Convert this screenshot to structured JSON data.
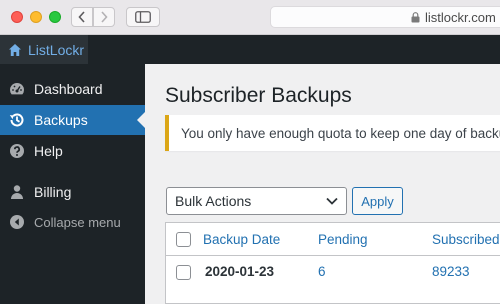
{
  "browser": {
    "url": "listlockr.com",
    "back_icon": "chevron-left-icon",
    "forward_icon": "chevron-right-icon",
    "sidebar_icon": "sidebar-toggle-icon",
    "lock_icon": "lock-icon"
  },
  "adminbar": {
    "site_name": "ListLockr",
    "home_icon": "home-icon"
  },
  "menu": {
    "items": [
      {
        "label": "Dashboard",
        "icon": "dashboard-icon"
      },
      {
        "label": "Backups",
        "icon": "backup-history-icon",
        "active": true
      },
      {
        "label": "Help",
        "icon": "help-icon"
      },
      {
        "label": "Billing",
        "icon": "user-icon"
      },
      {
        "label": "Collapse menu",
        "icon": "collapse-icon"
      }
    ]
  },
  "page": {
    "title": "Subscriber Backups",
    "notice": "You only have enough quota to keep one day of backups. U"
  },
  "bulk": {
    "selected": "Bulk Actions",
    "apply_label": "Apply"
  },
  "table": {
    "columns": [
      "Backup Date",
      "Pending",
      "Subscribed"
    ],
    "rows": [
      {
        "date": "2020-01-23",
        "pending": "6",
        "subscribed": "89233"
      }
    ]
  },
  "colors": {
    "accent": "#2271b1",
    "admin_bg": "#1d2327",
    "notice_border": "#dba617"
  }
}
